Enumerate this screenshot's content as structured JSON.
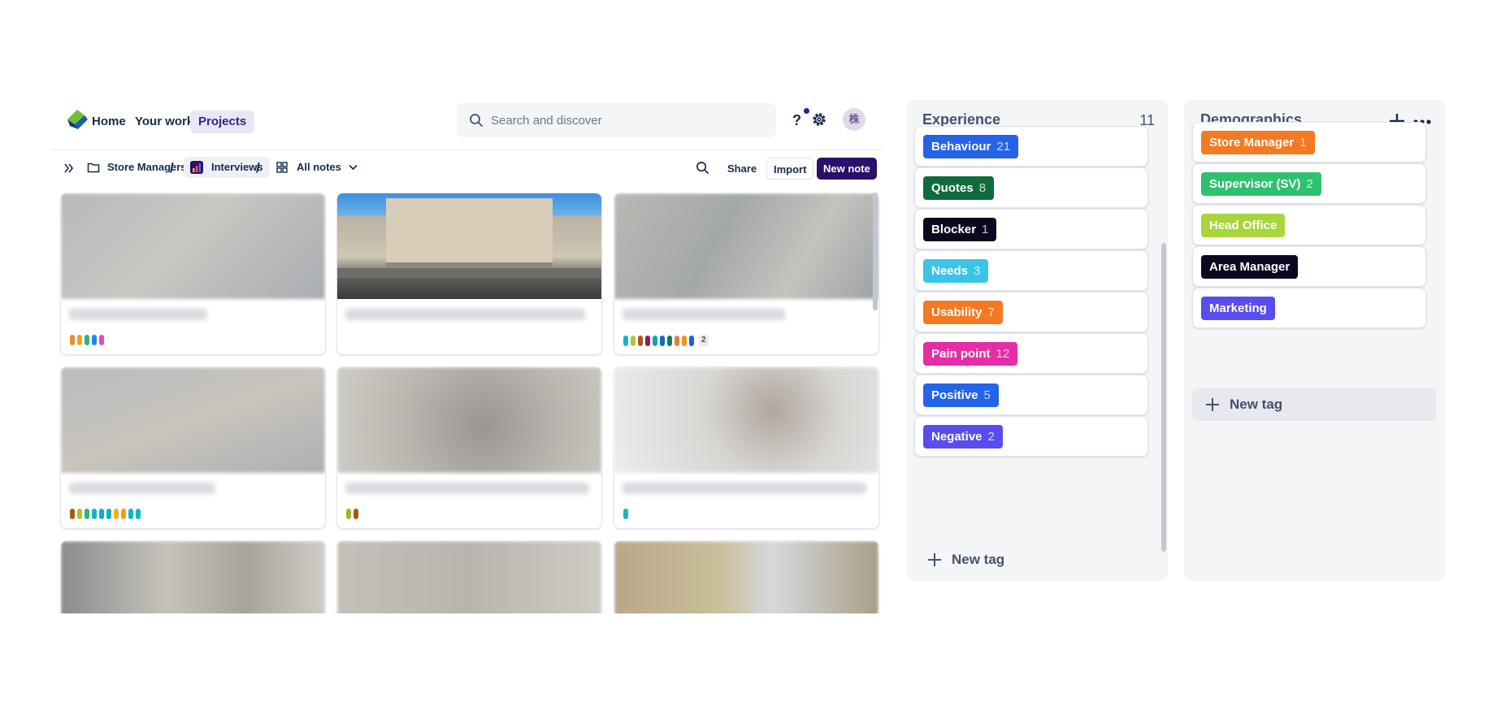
{
  "nav": {
    "home": "Home",
    "your_work": "Your work",
    "projects": "Projects",
    "search_placeholder": "Search and discover",
    "help": "?",
    "avatar": "株"
  },
  "subbar": {
    "folder": "Store Managers",
    "project": "Interviews",
    "view": "All notes",
    "share": "Share",
    "import": "Import",
    "new_note": "New note"
  },
  "cards": [
    {
      "pills": [
        "#f08a24",
        "#f0a21a",
        "#2bb673",
        "#1e88e5",
        "#e546c8"
      ],
      "more": ""
    },
    {
      "pills": [],
      "more": ""
    },
    {
      "pills": [
        "#17b3c4",
        "#b0c72a",
        "#a85a14",
        "#8e1e5a",
        "#14a3b0",
        "#1268c4",
        "#0f7a6a",
        "#ef7c2a",
        "#f19024",
        "#1a62d4"
      ],
      "more": "2"
    },
    {
      "pills": [
        "#a85a14",
        "#b6c12a",
        "#2bb673",
        "#17b3c4",
        "#1ea2d8",
        "#11b0c6",
        "#f0b01a",
        "#f09a24",
        "#17b3c4",
        "#17b3c4"
      ],
      "more": ""
    },
    {
      "pills": [
        "#9cb82a",
        "#a8561a"
      ],
      "more": ""
    },
    {
      "pills": [
        "#17b3c4"
      ],
      "more": ""
    }
  ],
  "experience": {
    "title": "Experience",
    "count": "11",
    "tags": [
      {
        "label": "Behaviour",
        "count": "21",
        "color": "#2563eb"
      },
      {
        "label": "Quotes",
        "count": "8",
        "color": "#0f6b3c"
      },
      {
        "label": "Blocker",
        "count": "1",
        "color": "#0b0820"
      },
      {
        "label": "Needs",
        "count": "3",
        "color": "#3cc4e6"
      },
      {
        "label": "Usability",
        "count": "7",
        "color": "#f47a21"
      },
      {
        "label": "Pain point",
        "count": "12",
        "color": "#e62da6"
      },
      {
        "label": "Positive",
        "count": "5",
        "color": "#2563eb"
      },
      {
        "label": "Negative",
        "count": "2",
        "color": "#5b4cf0"
      }
    ],
    "new_tag": "New tag"
  },
  "demographics": {
    "title": "Demographics",
    "tags": [
      {
        "label": "Store Manager",
        "count": "1",
        "color": "#f47a21"
      },
      {
        "label": "Supervisor (SV)",
        "count": "2",
        "color": "#2ec26e"
      },
      {
        "label": "Head Office",
        "count": "",
        "color": "#a6d63a"
      },
      {
        "label": "Area Manager",
        "count": "",
        "color": "#0b0820"
      },
      {
        "label": "Marketing",
        "count": "",
        "color": "#5b4cf0"
      }
    ],
    "new_tag": "New tag"
  }
}
